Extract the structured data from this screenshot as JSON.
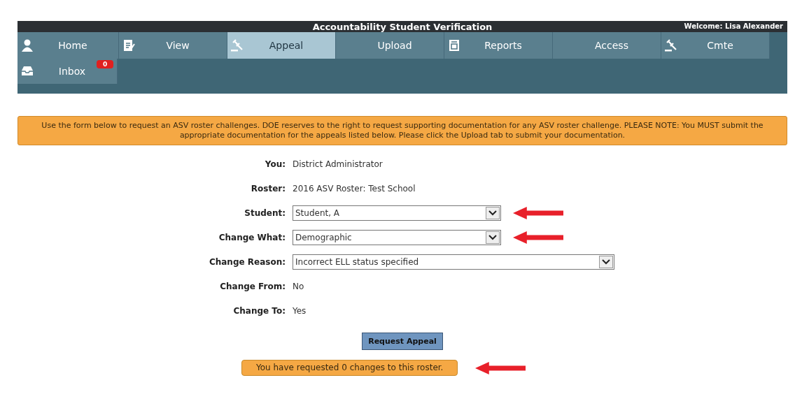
{
  "header": {
    "title": "Accountability Student Verification",
    "welcome": "Welcome: Lisa Alexander"
  },
  "nav": [
    {
      "label": "Home",
      "kind": "person",
      "selected": false
    },
    {
      "label": "View",
      "kind": "document",
      "selected": false
    },
    {
      "label": "Appeal",
      "kind": "gavel",
      "selected": true
    },
    {
      "label": "Upload",
      "kind": "plain",
      "selected": false
    },
    {
      "label": "Reports",
      "kind": "report",
      "selected": false
    },
    {
      "label": "Access",
      "kind": "plain",
      "selected": false
    },
    {
      "label": "Cmte",
      "kind": "gavel",
      "selected": false
    }
  ],
  "nav_row_2": [
    {
      "label": "Inbox",
      "kind": "inbox",
      "selected": false,
      "badge": "0"
    }
  ],
  "notice": "Use the form below to request an ASV roster challenges. DOE reserves to the right to request supporting documentation for any ASV roster challenge. PLEASE NOTE: You MUST submit the appropriate documentation for the appeals listed below. Please click the Upload tab to submit your documentation.",
  "form": [
    {
      "label": "You:",
      "kind": "text",
      "value": "District Administrator",
      "marked": false
    },
    {
      "label": "Roster:",
      "kind": "text",
      "value": "2016 ASV Roster:  Test School",
      "marked": false
    },
    {
      "label": "Student:",
      "kind": "select",
      "value": "Student, A",
      "marked": true
    },
    {
      "label": "Change What:",
      "kind": "select",
      "value": "Demographic",
      "marked": true
    },
    {
      "label": "Change Reason:",
      "kind": "wide-select",
      "value": "Incorrect ELL status specified",
      "marked": false
    },
    {
      "label": "Change From:",
      "kind": "text",
      "value": "No",
      "marked": false
    },
    {
      "label": "Change To:",
      "kind": "text",
      "value": "Yes",
      "marked": false
    }
  ],
  "submit_button": "Request Appeal",
  "status": {
    "text": "You have requested 0 changes to this roster.",
    "marked": true
  }
}
